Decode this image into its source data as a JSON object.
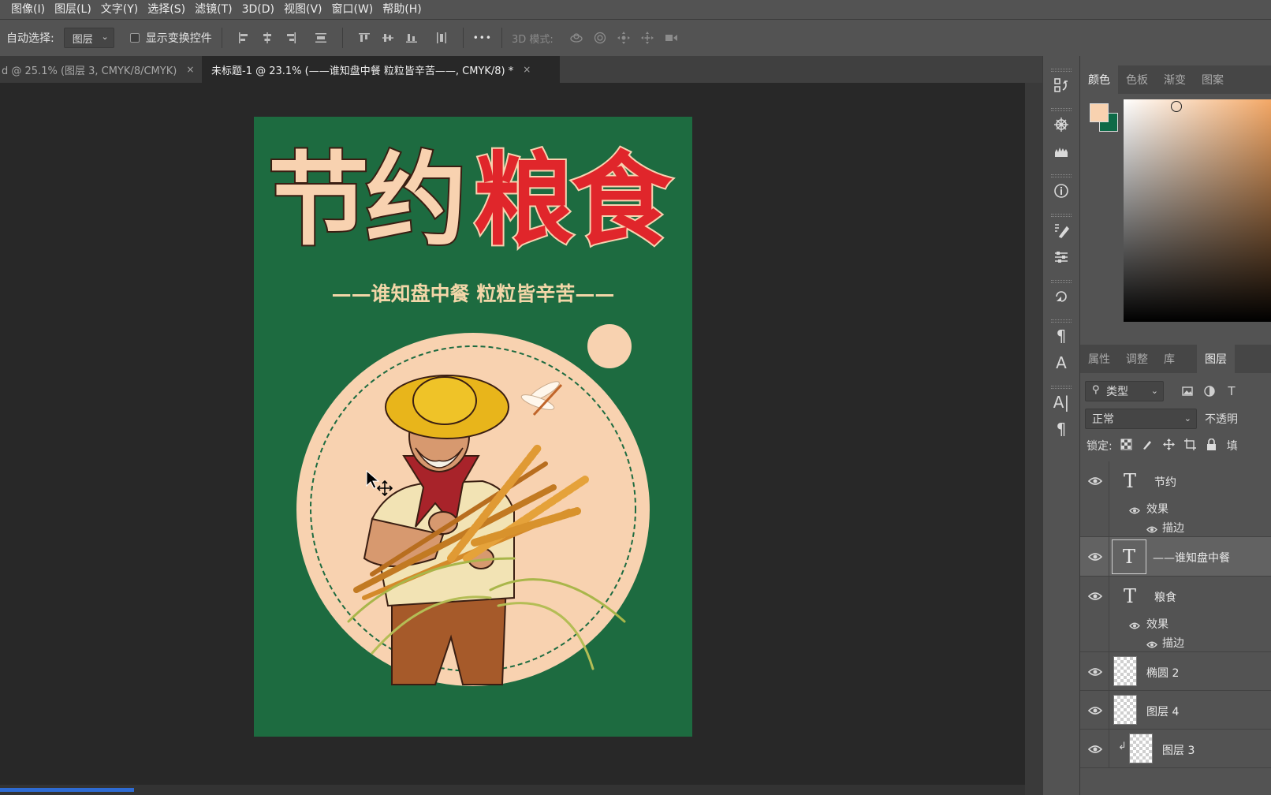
{
  "menu": [
    "图像(I)",
    "图层(L)",
    "文字(Y)",
    "选择(S)",
    "滤镜(T)",
    "3D(D)",
    "视图(V)",
    "窗口(W)",
    "帮助(H)"
  ],
  "options": {
    "auto_select_label": "自动选择:",
    "auto_select_value": "图层",
    "show_transform_label": "显示变换控件",
    "more": "•••",
    "mode_label": "3D 模式:"
  },
  "doc_tabs": [
    {
      "label": "d @ 25.1% (图层 3, CMYK/8/CMYK)",
      "close": "×"
    },
    {
      "label": "未标题-1 @ 23.1% (——谁知盘中餐  粒粒皆辛苦——, CMYK/8) *",
      "close": "×"
    }
  ],
  "poster": {
    "title_part1": "节约",
    "title_part2": "粮食",
    "subtitle": "——谁知盘中餐  粒粒皆辛苦——",
    "colors": {
      "background": "#1d6b40",
      "cream": "#f8d2b0",
      "red": "#e0262b",
      "subtitle": "#f2d6a8"
    }
  },
  "panels": {
    "collapse_arrows": "‹‹",
    "color_tabs": [
      "颜色",
      "色板",
      "渐变",
      "图案"
    ],
    "fg_color": "#f8d2b0",
    "bg_color": "#0d6a47",
    "layer_panel_tabs": [
      "属性",
      "调整",
      "库",
      "图层"
    ],
    "filter_kind": "类型",
    "blend_mode": "正常",
    "opacity_label": "不透明",
    "lock_label": "锁定:",
    "fill_label": "填"
  },
  "layers": [
    {
      "name": "节约",
      "kind": "text",
      "effects_label": "效果",
      "effect": "描边"
    },
    {
      "name": "——谁知盘中餐",
      "kind": "text",
      "selected": true
    },
    {
      "name": "粮食",
      "kind": "text",
      "effects_label": "效果",
      "effect": "描边"
    },
    {
      "name": "椭圆 2",
      "kind": "shape"
    },
    {
      "name": "图层 4",
      "kind": "pixel"
    },
    {
      "name": "图层 3",
      "kind": "pixel",
      "clipped": true
    }
  ]
}
